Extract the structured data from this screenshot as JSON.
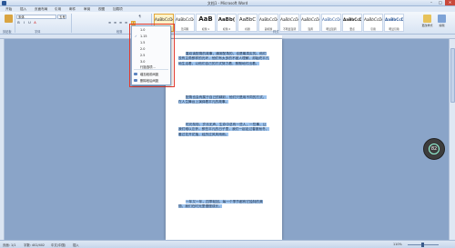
{
  "titlebar": {
    "title": "文档1 - Microsoft Word",
    "min": "–",
    "max": "□",
    "close": "✕"
  },
  "tabs": [
    "开始",
    "插入",
    "页面布局",
    "引用",
    "邮件",
    "审阅",
    "视图",
    "加载项"
  ],
  "ribbon": {
    "font_name": "宋体",
    "font_size": "五号",
    "groups": [
      "剪贴板",
      "字体",
      "段落",
      "样式",
      "编辑"
    ],
    "format_buttons": [
      "B",
      "I",
      "U",
      "A",
      "≡",
      "≡",
      "≡",
      "≡",
      "↕",
      "¶"
    ],
    "styles": [
      {
        "sample": "AaBbCcDc",
        "name": "正文"
      },
      {
        "sample": "AaBbCcDc",
        "name": "无间隔"
      },
      {
        "sample": "AaB",
        "name": "标题 1"
      },
      {
        "sample": "AaBb(",
        "name": "标题 2"
      },
      {
        "sample": "AaBbC",
        "name": "标题"
      },
      {
        "sample": "AaBbCcDc",
        "name": "副标题"
      },
      {
        "sample": "AaBbCcDc",
        "name": "不明显强调"
      },
      {
        "sample": "AaBbCcDc",
        "name": "强调"
      },
      {
        "sample": "AaBbCcDc",
        "name": "明显强调"
      },
      {
        "sample": "AaBbCcDc",
        "name": "要点"
      },
      {
        "sample": "AaBbCcDc",
        "name": "引用"
      },
      {
        "sample": "AaBbCcDc",
        "name": "明显引用"
      }
    ],
    "change_styles": "更改样式",
    "edit": "编辑"
  },
  "line_spacing_menu": {
    "options": [
      "1.0",
      "1.15",
      "1.5",
      "2.0",
      "2.5",
      "3.0"
    ],
    "checked": "1.15",
    "more": "行距选项...",
    "add_before": "增加段前间距",
    "remove_after": "删除段后间距"
  },
  "document": {
    "paragraphs": [
      "喜欢读配角的故事，通常配角的，也是最真实的。他们没有主角那样的光环，他们有太多的不被人理解，却始终平凡地生活着，以他们自己的方式努力着，默默地付出着。",
      "配角也会有属于自己的精彩，他们只是用不同的方式，在人生舞台上演绎着平凡的故事。",
      "时光匆匆，岁月无声。生命中总有一些人，一些事，让我们难以忘怀。那些平凡的日子里，我们一起走过春夏秋冬，看过花开花落，经历过风风雨雨。",
      "一年又一年，四季轮回，每一个季节都有它独特的美丽，我们在时光里慢慢成长。"
    ]
  },
  "statusbar": {
    "page": "页面: 1/1",
    "words": "字数: 402/402",
    "language": "中文(中国)",
    "mode": "插入",
    "zoom": "110%"
  },
  "float_widget": {
    "value": "82"
  },
  "colors": {
    "accent": "#2b5797",
    "selection": "#9cc2ec",
    "annotation": "#e23a2f"
  }
}
